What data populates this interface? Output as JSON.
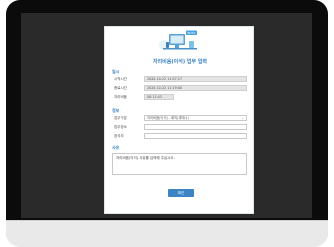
{
  "dialog": {
    "title": "자리비움(이석) 업무 입력",
    "sections": {
      "period": "일시",
      "info": "정보",
      "memo": "사유"
    },
    "fields": [
      {
        "label": "시작시간",
        "value": "2020-10-22 11:07:17"
      },
      {
        "label": "종료시간",
        "value": "2020-10-22 11:19:00"
      },
      {
        "label": "자리비움",
        "value": "00:11:43"
      }
    ],
    "info_fields": [
      {
        "label": "업무구분",
        "value": "자리비움(이석) - 회의(세미나)"
      },
      {
        "label": "업무장소",
        "value": ""
      },
      {
        "label": "참석자",
        "value": ""
      }
    ],
    "memo_placeholder": "자리비움(이석) 사유를 입력해 주십시오.",
    "ok_label": "확인",
    "badge_text": "BUSY"
  }
}
